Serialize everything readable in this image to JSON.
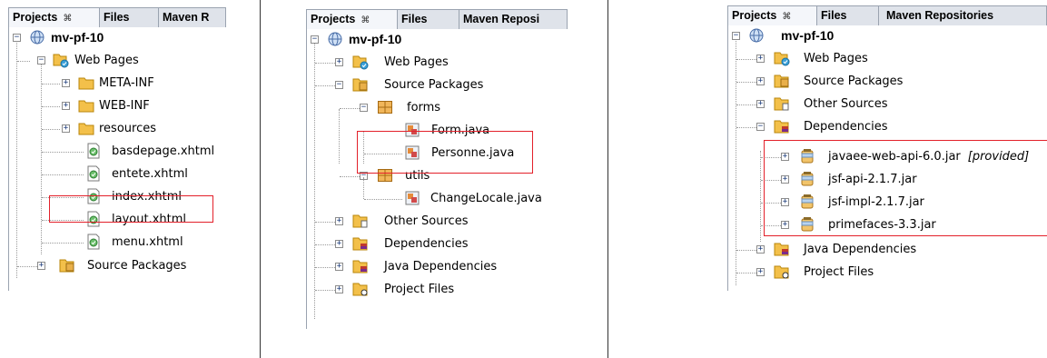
{
  "tabs": {
    "projects": "Projects",
    "close_glyph": "⌘",
    "files": "Files",
    "maven_p1": "Maven R",
    "maven_p2": "Maven Reposi",
    "maven_p3": "Maven Repositories"
  },
  "p1": {
    "project": "mv-pf-10",
    "web_pages": "Web Pages",
    "meta_inf": "META-INF",
    "web_inf": "WEB-INF",
    "resources": "resources",
    "f1": "basdepage.xhtml",
    "f2": "entete.xhtml",
    "f3": "index.xhtml",
    "f4": "layout.xhtml",
    "f5": "menu.xhtml",
    "source_packages": "Source Packages"
  },
  "p2": {
    "project": "mv-pf-10",
    "web_pages": "Web Pages",
    "source_packages": "Source Packages",
    "forms": "forms",
    "form_java": "Form.java",
    "personne_java": "Personne.java",
    "utils": "utils",
    "changelocale_java": "ChangeLocale.java",
    "other_sources": "Other Sources",
    "dependencies": "Dependencies",
    "java_dependencies": "Java Dependencies",
    "project_files": "Project Files"
  },
  "p3": {
    "project": "mv-pf-10",
    "web_pages": "Web Pages",
    "source_packages": "Source Packages",
    "other_sources": "Other Sources",
    "dependencies": "Dependencies",
    "jar1": "javaee-web-api-6.0.jar",
    "jar1_tag": "[provided]",
    "jar2": "jsf-api-2.1.7.jar",
    "jar3": "jsf-impl-2.1.7.jar",
    "jar4": "primefaces-3.3.jar",
    "java_dependencies": "Java Dependencies",
    "project_files": "Project Files"
  },
  "colors": {
    "highlight": "#e3202a",
    "tab_bg": "#dfe3ea"
  }
}
